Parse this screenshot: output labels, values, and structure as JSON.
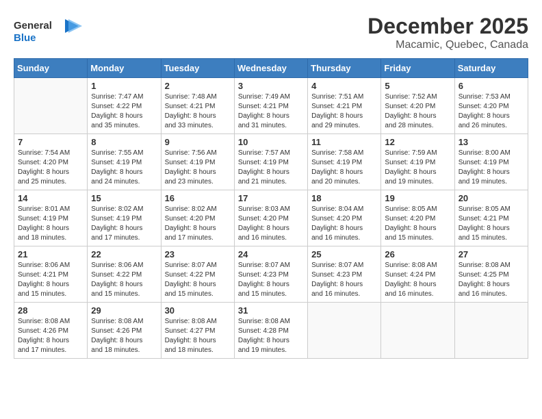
{
  "header": {
    "logo_line1": "General",
    "logo_line2": "Blue",
    "month": "December 2025",
    "location": "Macamic, Quebec, Canada"
  },
  "weekdays": [
    "Sunday",
    "Monday",
    "Tuesday",
    "Wednesday",
    "Thursday",
    "Friday",
    "Saturday"
  ],
  "weeks": [
    [
      {
        "day": "",
        "info": ""
      },
      {
        "day": "1",
        "info": "Sunrise: 7:47 AM\nSunset: 4:22 PM\nDaylight: 8 hours\nand 35 minutes."
      },
      {
        "day": "2",
        "info": "Sunrise: 7:48 AM\nSunset: 4:21 PM\nDaylight: 8 hours\nand 33 minutes."
      },
      {
        "day": "3",
        "info": "Sunrise: 7:49 AM\nSunset: 4:21 PM\nDaylight: 8 hours\nand 31 minutes."
      },
      {
        "day": "4",
        "info": "Sunrise: 7:51 AM\nSunset: 4:21 PM\nDaylight: 8 hours\nand 29 minutes."
      },
      {
        "day": "5",
        "info": "Sunrise: 7:52 AM\nSunset: 4:20 PM\nDaylight: 8 hours\nand 28 minutes."
      },
      {
        "day": "6",
        "info": "Sunrise: 7:53 AM\nSunset: 4:20 PM\nDaylight: 8 hours\nand 26 minutes."
      }
    ],
    [
      {
        "day": "7",
        "info": "Sunrise: 7:54 AM\nSunset: 4:20 PM\nDaylight: 8 hours\nand 25 minutes."
      },
      {
        "day": "8",
        "info": "Sunrise: 7:55 AM\nSunset: 4:19 PM\nDaylight: 8 hours\nand 24 minutes."
      },
      {
        "day": "9",
        "info": "Sunrise: 7:56 AM\nSunset: 4:19 PM\nDaylight: 8 hours\nand 23 minutes."
      },
      {
        "day": "10",
        "info": "Sunrise: 7:57 AM\nSunset: 4:19 PM\nDaylight: 8 hours\nand 21 minutes."
      },
      {
        "day": "11",
        "info": "Sunrise: 7:58 AM\nSunset: 4:19 PM\nDaylight: 8 hours\nand 20 minutes."
      },
      {
        "day": "12",
        "info": "Sunrise: 7:59 AM\nSunset: 4:19 PM\nDaylight: 8 hours\nand 19 minutes."
      },
      {
        "day": "13",
        "info": "Sunrise: 8:00 AM\nSunset: 4:19 PM\nDaylight: 8 hours\nand 19 minutes."
      }
    ],
    [
      {
        "day": "14",
        "info": "Sunrise: 8:01 AM\nSunset: 4:19 PM\nDaylight: 8 hours\nand 18 minutes."
      },
      {
        "day": "15",
        "info": "Sunrise: 8:02 AM\nSunset: 4:19 PM\nDaylight: 8 hours\nand 17 minutes."
      },
      {
        "day": "16",
        "info": "Sunrise: 8:02 AM\nSunset: 4:20 PM\nDaylight: 8 hours\nand 17 minutes."
      },
      {
        "day": "17",
        "info": "Sunrise: 8:03 AM\nSunset: 4:20 PM\nDaylight: 8 hours\nand 16 minutes."
      },
      {
        "day": "18",
        "info": "Sunrise: 8:04 AM\nSunset: 4:20 PM\nDaylight: 8 hours\nand 16 minutes."
      },
      {
        "day": "19",
        "info": "Sunrise: 8:05 AM\nSunset: 4:20 PM\nDaylight: 8 hours\nand 15 minutes."
      },
      {
        "day": "20",
        "info": "Sunrise: 8:05 AM\nSunset: 4:21 PM\nDaylight: 8 hours\nand 15 minutes."
      }
    ],
    [
      {
        "day": "21",
        "info": "Sunrise: 8:06 AM\nSunset: 4:21 PM\nDaylight: 8 hours\nand 15 minutes."
      },
      {
        "day": "22",
        "info": "Sunrise: 8:06 AM\nSunset: 4:22 PM\nDaylight: 8 hours\nand 15 minutes."
      },
      {
        "day": "23",
        "info": "Sunrise: 8:07 AM\nSunset: 4:22 PM\nDaylight: 8 hours\nand 15 minutes."
      },
      {
        "day": "24",
        "info": "Sunrise: 8:07 AM\nSunset: 4:23 PM\nDaylight: 8 hours\nand 15 minutes."
      },
      {
        "day": "25",
        "info": "Sunrise: 8:07 AM\nSunset: 4:23 PM\nDaylight: 8 hours\nand 16 minutes."
      },
      {
        "day": "26",
        "info": "Sunrise: 8:08 AM\nSunset: 4:24 PM\nDaylight: 8 hours\nand 16 minutes."
      },
      {
        "day": "27",
        "info": "Sunrise: 8:08 AM\nSunset: 4:25 PM\nDaylight: 8 hours\nand 16 minutes."
      }
    ],
    [
      {
        "day": "28",
        "info": "Sunrise: 8:08 AM\nSunset: 4:26 PM\nDaylight: 8 hours\nand 17 minutes."
      },
      {
        "day": "29",
        "info": "Sunrise: 8:08 AM\nSunset: 4:26 PM\nDaylight: 8 hours\nand 18 minutes."
      },
      {
        "day": "30",
        "info": "Sunrise: 8:08 AM\nSunset: 4:27 PM\nDaylight: 8 hours\nand 18 minutes."
      },
      {
        "day": "31",
        "info": "Sunrise: 8:08 AM\nSunset: 4:28 PM\nDaylight: 8 hours\nand 19 minutes."
      },
      {
        "day": "",
        "info": ""
      },
      {
        "day": "",
        "info": ""
      },
      {
        "day": "",
        "info": ""
      }
    ]
  ]
}
